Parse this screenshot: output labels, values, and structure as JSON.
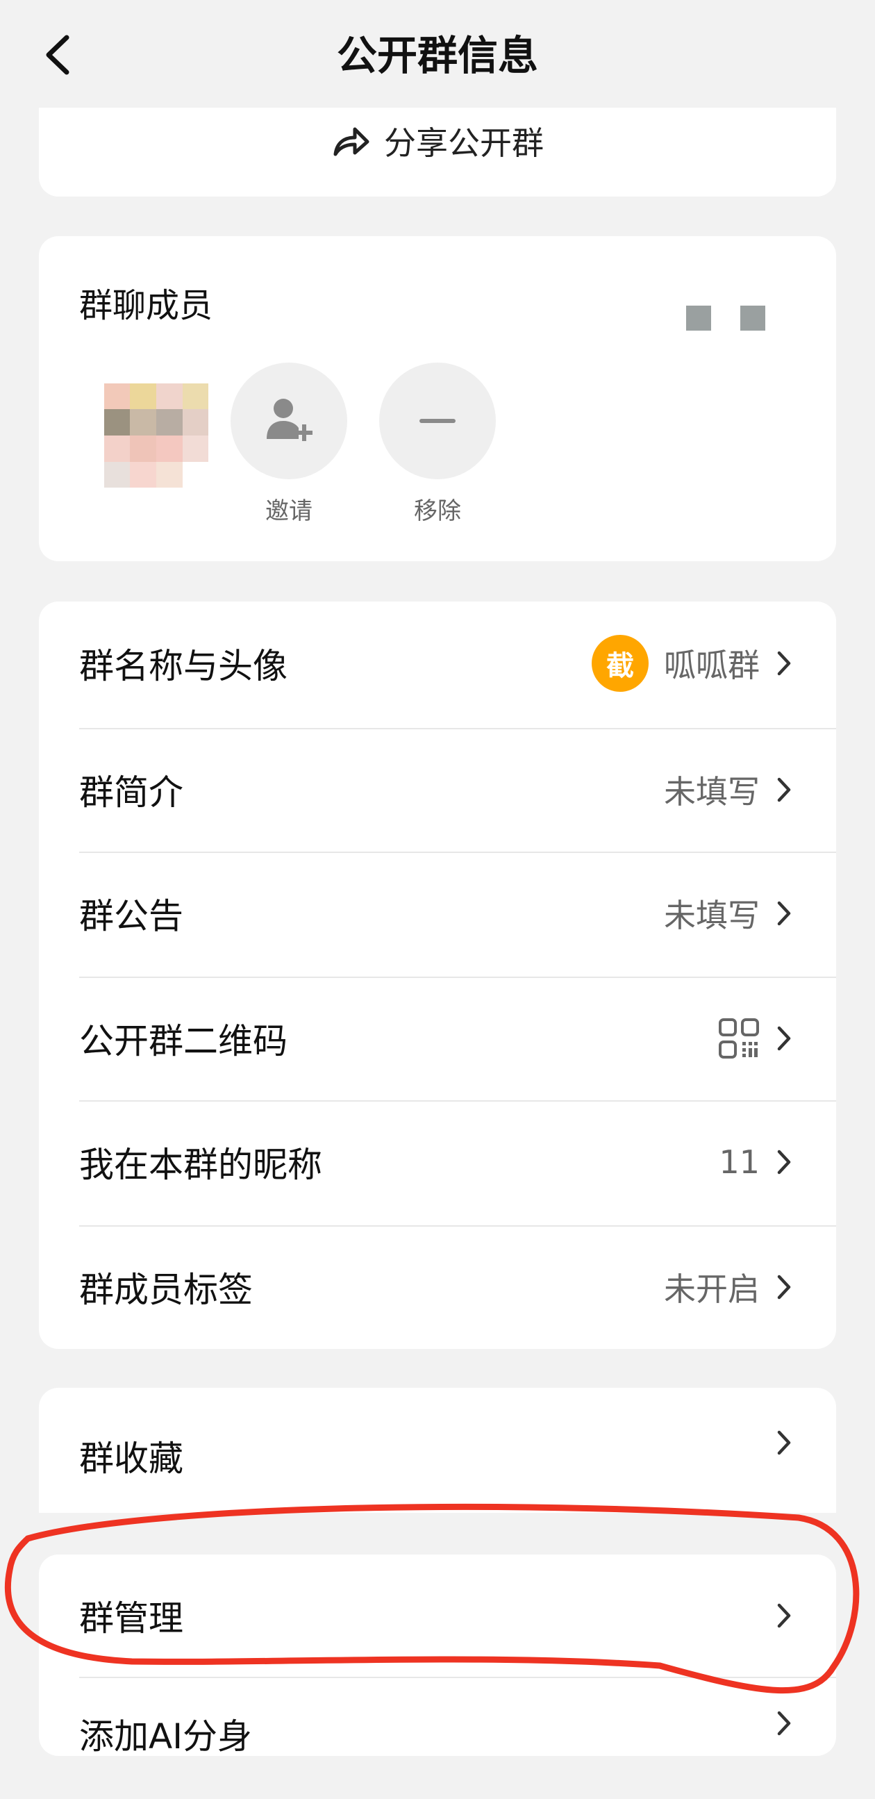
{
  "header": {
    "title": "公开群信息"
  },
  "share": {
    "label": "分享公开群"
  },
  "members": {
    "title": "群聊成员",
    "invite_label": "邀请",
    "remove_label": "移除"
  },
  "settings": {
    "rows": [
      {
        "label": "群名称与头像",
        "badge": "截",
        "value": "呱呱群"
      },
      {
        "label": "群简介",
        "value": "未填写"
      },
      {
        "label": "群公告",
        "value": "未填写"
      },
      {
        "label": "公开群二维码",
        "value_icon": "qr-code-icon"
      },
      {
        "label": "我在本群的昵称",
        "value": "11"
      },
      {
        "label": "群成员标签",
        "value": "未开启"
      }
    ]
  },
  "favorites": {
    "label": "群收藏"
  },
  "manage": {
    "label": "群管理"
  },
  "ai": {
    "label": "添加AI分身"
  },
  "annotation": {
    "color": "#ee3322"
  }
}
